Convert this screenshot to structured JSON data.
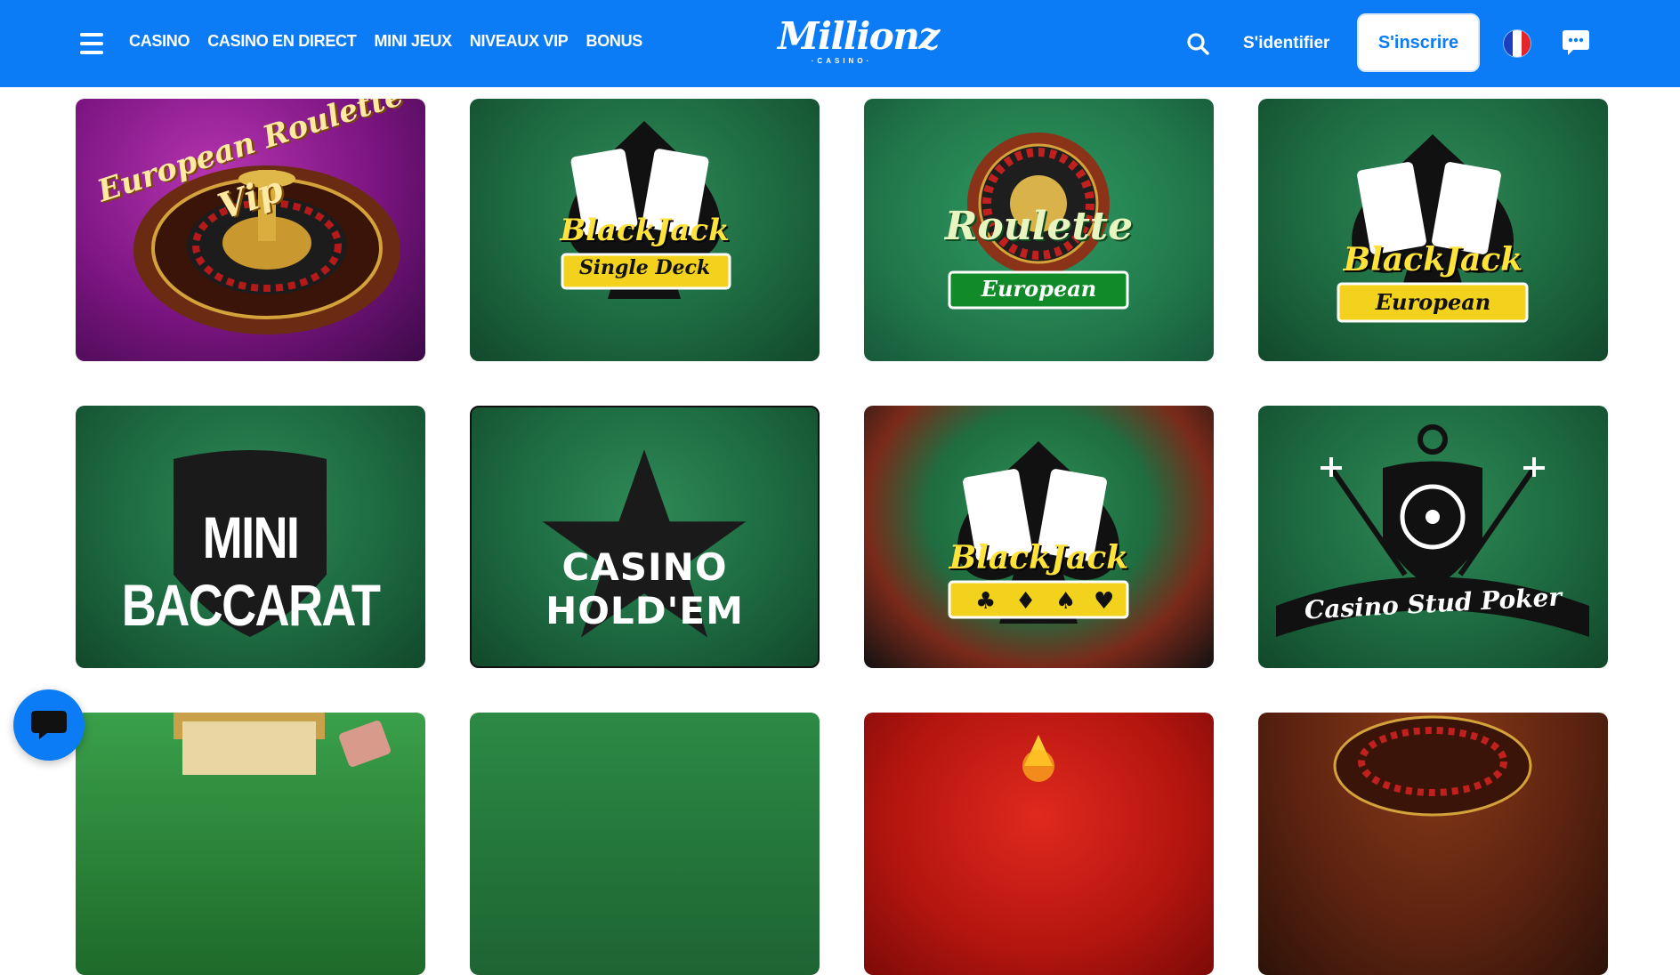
{
  "header": {
    "nav": [
      "CASINO",
      "CASINO EN DIRECT",
      "MINI JEUX",
      "NIVEAUX VIP",
      "BONUS"
    ],
    "logo_text": "Millionz",
    "logo_subtext": "·CASINO·",
    "login_label": "S'identifier",
    "signup_label": "S'inscrire",
    "language": "fr",
    "colors": {
      "brand": "#0b7cf5"
    }
  },
  "games": [
    {
      "lines": [
        "European Roulette",
        "Vip"
      ]
    },
    {
      "lines": [
        "BlackJack",
        "Single Deck"
      ]
    },
    {
      "lines": [
        "Roulette",
        "European"
      ]
    },
    {
      "lines": [
        "BlackJack",
        "European"
      ]
    },
    {
      "lines": [
        "MINI BACCARAT"
      ]
    },
    {
      "lines": [
        "CASINO HOLD'EM"
      ]
    },
    {
      "lines": [
        "BlackJack"
      ]
    },
    {
      "lines": [
        "Casino Stud Poker"
      ]
    }
  ],
  "icons": [
    "hamburger-menu-icon",
    "search-icon",
    "flag-fr-icon",
    "chat-icon"
  ]
}
